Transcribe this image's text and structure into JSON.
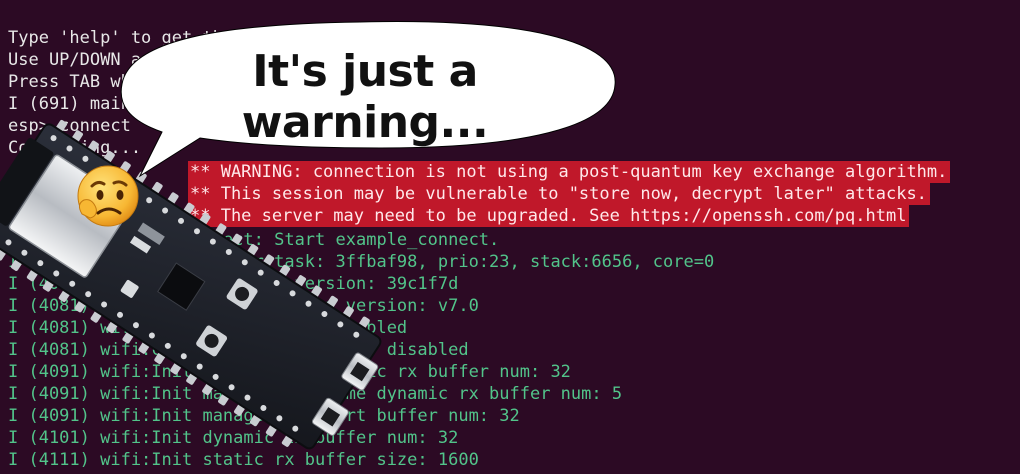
{
  "terminal": {
    "prompt_lines": [
      "Type 'help' to get the list of commands.",
      "Use UP/DOWN arrows to navigate through command history.",
      "Press TAB when typing command name to auto-complete.",
      "I (691) main_task: Returned from app_main()",
      "esp> connect",
      "Connecting..."
    ],
    "warning_lines": [
      "** WARNING: connection is not using a post-quantum key exchange algorithm.",
      "** This session may be vulnerable to \"store now, decrypt later\" attacks.",
      "** The server may need to be upgraded. See https://openssh.com/pq.html"
    ],
    "log_lines": [
      "I (4071) example_connect: Start example_connect.",
      "I (4081) wifi:wifi driver task: 3ffbaf98, prio:23, stack:6656, core=0",
      "I (4081) wifi:wifi firmware version: 39c1f7d",
      "I (4081) wifi:wifi certification version: v7.0",
      "I (4081) wifi:config NVS flash: enabled",
      "I (4081) wifi:config nano formating: disabled",
      "I (4091) wifi:Init data frame dynamic rx buffer num: 32",
      "I (4091) wifi:Init management frame dynamic rx buffer num: 5",
      "I (4091) wifi:Init management short buffer num: 32",
      "I (4101) wifi:Init dynamic tx buffer num: 32",
      "I (4111) wifi:Init static rx buffer size: 1600"
    ]
  },
  "overlay": {
    "bubble_text": "It's just a warning...",
    "emoji_icon": "thinking-worried-face-icon",
    "board_icon": "esp32-dev-board-icon"
  },
  "colors": {
    "background": "#2c0a24",
    "log_green": "#52c48a",
    "warning_red": "#c0182a"
  }
}
